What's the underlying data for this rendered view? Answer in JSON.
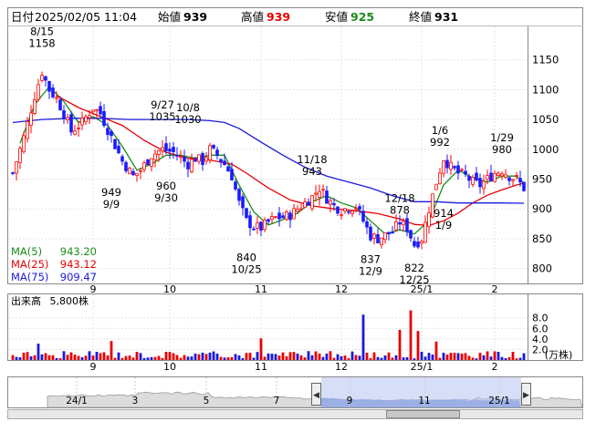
{
  "header": {
    "date_label": "日付",
    "datetime": "2025/02/05 11:04",
    "open_label": "始値",
    "open_value": "939",
    "high_label": "高値",
    "high_value": "939",
    "low_label": "安値",
    "low_value": "925",
    "close_label": "終値",
    "close_value": "931"
  },
  "colors": {
    "up": "#ff0000",
    "down": "#1a1aff",
    "ma5": "#1a8c1a",
    "ma25": "#e60000",
    "ma75": "#1a1adc",
    "vol_up": "#e60000",
    "vol_down": "#1a1adc",
    "navigator_fill": "#aabbee"
  },
  "ma_legend": [
    {
      "label": "MA(5)",
      "value": "943.20",
      "color": "#1a8c1a"
    },
    {
      "label": "MA(25)",
      "value": "943.12",
      "color": "#e60000"
    },
    {
      "label": "MA(75)",
      "value": "909.47",
      "color": "#1a1adc"
    }
  ],
  "volume_panel": {
    "label": "出来高",
    "value": "5,800株",
    "unit": "(万株)"
  },
  "navigator": {
    "labels": [
      "24/1",
      "3",
      "5",
      "7",
      "9",
      "11",
      "25/1"
    ],
    "left_arrow": "◀",
    "right_arrow": "▶"
  },
  "chart_data": {
    "type": "candlestick",
    "price_axis": {
      "ticks": [
        800,
        850,
        900,
        950,
        1000,
        1050,
        1100,
        1150
      ],
      "ylim": [
        778,
        1203
      ]
    },
    "volume_axis": {
      "ticks": [
        2.0,
        4.0,
        6.0,
        8.0
      ],
      "ylim": [
        0,
        9.5
      ],
      "unit": "万株"
    },
    "x_ticks": [
      "9",
      "10",
      "11",
      "12",
      "25/1",
      "2"
    ],
    "close_path": [
      [
        0,
        960
      ],
      [
        3,
        1020
      ],
      [
        6,
        1090
      ],
      [
        8,
        1130
      ],
      [
        10,
        1100
      ],
      [
        12,
        1085
      ],
      [
        14,
        1060
      ],
      [
        16,
        1030
      ],
      [
        19,
        1045
      ],
      [
        22,
        1070
      ],
      [
        24,
        1060
      ],
      [
        27,
        1020
      ],
      [
        30,
        980
      ],
      [
        33,
        955
      ],
      [
        35,
        965
      ],
      [
        38,
        990
      ],
      [
        41,
        1000
      ],
      [
        44,
        995
      ],
      [
        46,
        985
      ],
      [
        48,
        975
      ],
      [
        50,
        985
      ],
      [
        52,
        980
      ],
      [
        54,
        1000
      ],
      [
        56,
        990
      ],
      [
        58,
        975
      ],
      [
        60,
        955
      ],
      [
        62,
        910
      ],
      [
        64,
        880
      ],
      [
        66,
        870
      ],
      [
        68,
        868
      ],
      [
        70,
        878
      ],
      [
        72,
        885
      ],
      [
        74,
        886
      ],
      [
        76,
        890
      ],
      [
        78,
        900
      ],
      [
        80,
        910
      ],
      [
        82,
        920
      ],
      [
        84,
        935
      ],
      [
        86,
        918
      ],
      [
        88,
        905
      ],
      [
        90,
        898
      ],
      [
        92,
        902
      ],
      [
        94,
        905
      ],
      [
        96,
        880
      ],
      [
        98,
        855
      ],
      [
        100,
        850
      ],
      [
        102,
        856
      ],
      [
        104,
        862
      ],
      [
        106,
        878
      ],
      [
        108,
        868
      ],
      [
        110,
        840
      ],
      [
        112,
        850
      ],
      [
        114,
        900
      ],
      [
        116,
        945
      ],
      [
        118,
        985
      ],
      [
        120,
        970
      ],
      [
        122,
        960
      ],
      [
        124,
        955
      ],
      [
        126,
        945
      ],
      [
        128,
        940
      ],
      [
        130,
        950
      ],
      [
        132,
        960
      ],
      [
        134,
        965
      ],
      [
        136,
        955
      ],
      [
        138,
        950
      ],
      [
        140,
        935
      ]
    ],
    "series": [
      {
        "name": "MA(5)",
        "points": [
          [
            2,
            1010
          ],
          [
            6,
            1075
          ],
          [
            10,
            1105
          ],
          [
            14,
            1080
          ],
          [
            18,
            1045
          ],
          [
            22,
            1055
          ],
          [
            26,
            1040
          ],
          [
            30,
            1005
          ],
          [
            34,
            965
          ],
          [
            38,
            975
          ],
          [
            42,
            990
          ],
          [
            46,
            990
          ],
          [
            50,
            985
          ],
          [
            54,
            990
          ],
          [
            58,
            990
          ],
          [
            62,
            940
          ],
          [
            66,
            895
          ],
          [
            70,
            873
          ],
          [
            74,
            882
          ],
          [
            78,
            893
          ],
          [
            82,
            912
          ],
          [
            86,
            922
          ],
          [
            90,
            910
          ],
          [
            94,
            902
          ],
          [
            98,
            880
          ],
          [
            102,
            858
          ],
          [
            106,
            865
          ],
          [
            110,
            858
          ],
          [
            114,
            880
          ],
          [
            118,
            940
          ],
          [
            122,
            965
          ],
          [
            126,
            952
          ],
          [
            130,
            945
          ],
          [
            134,
            955
          ],
          [
            138,
            955
          ],
          [
            140,
            943.2
          ]
        ]
      },
      {
        "name": "MA(25)",
        "points": [
          [
            12,
            1090
          ],
          [
            18,
            1070
          ],
          [
            24,
            1055
          ],
          [
            30,
            1040
          ],
          [
            36,
            1015
          ],
          [
            42,
            995
          ],
          [
            48,
            985
          ],
          [
            54,
            982
          ],
          [
            60,
            975
          ],
          [
            64,
            960
          ],
          [
            70,
            935
          ],
          [
            76,
            915
          ],
          [
            82,
            905
          ],
          [
            88,
            900
          ],
          [
            94,
            897
          ],
          [
            100,
            892
          ],
          [
            106,
            883
          ],
          [
            110,
            874
          ],
          [
            114,
            872
          ],
          [
            118,
            880
          ],
          [
            122,
            893
          ],
          [
            126,
            910
          ],
          [
            130,
            923
          ],
          [
            134,
            932
          ],
          [
            138,
            940
          ],
          [
            140,
            943.12
          ]
        ]
      },
      {
        "name": "MA(75)",
        "points": [
          [
            0,
            1045
          ],
          [
            8,
            1050
          ],
          [
            16,
            1052
          ],
          [
            24,
            1052
          ],
          [
            32,
            1050
          ],
          [
            40,
            1050
          ],
          [
            48,
            1050
          ],
          [
            54,
            1048
          ],
          [
            58,
            1045
          ],
          [
            62,
            1035
          ],
          [
            68,
            1012
          ],
          [
            74,
            990
          ],
          [
            80,
            970
          ],
          [
            86,
            955
          ],
          [
            92,
            945
          ],
          [
            98,
            935
          ],
          [
            104,
            922
          ],
          [
            110,
            912
          ],
          [
            116,
            912
          ],
          [
            122,
            910
          ],
          [
            128,
            910
          ],
          [
            134,
            910
          ],
          [
            140,
            909.47
          ]
        ]
      }
    ],
    "annotations": [
      {
        "label": "8/15",
        "value": "1158",
        "x": 8,
        "price": 1158
      },
      {
        "label": "949",
        "value": "9/9",
        "x": 27,
        "price": 949
      },
      {
        "label": "9/27",
        "value": "1035",
        "x": 41,
        "price": 1035
      },
      {
        "label": "10/8",
        "value": "1030",
        "x": 48,
        "price": 1030
      },
      {
        "label": "960",
        "value": "9/30",
        "x": 42,
        "price": 960
      },
      {
        "label": "840",
        "value": "10/25",
        "x": 64,
        "price": 840
      },
      {
        "label": "11/18",
        "value": "943",
        "x": 82,
        "price": 943
      },
      {
        "label": "837",
        "value": "12/9",
        "x": 98,
        "price": 837
      },
      {
        "label": "12/18",
        "value": "878",
        "x": 106,
        "price": 878
      },
      {
        "label": "822",
        "value": "12/25",
        "x": 110,
        "price": 822
      },
      {
        "label": "1/6",
        "value": "992",
        "x": 117,
        "price": 992
      },
      {
        "label": "914",
        "value": "1/9",
        "x": 118,
        "price": 914
      },
      {
        "label": "1/29",
        "value": "980",
        "x": 134,
        "price": 980
      }
    ],
    "volume_peaks": [
      [
        7,
        3.1
      ],
      [
        27,
        3.6
      ],
      [
        68,
        4.1
      ],
      [
        96,
        8.6
      ],
      [
        106,
        5.7
      ],
      [
        109,
        9.4
      ],
      [
        111,
        5.5
      ],
      [
        116,
        3.5
      ]
    ]
  }
}
